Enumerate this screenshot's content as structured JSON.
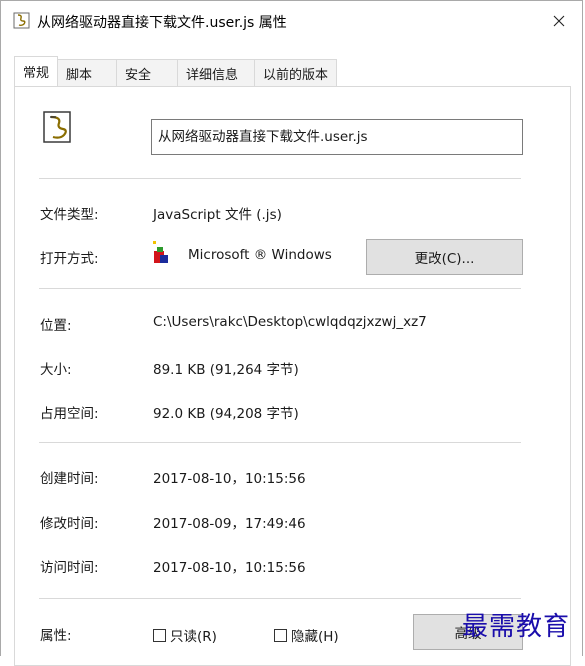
{
  "window": {
    "title": "从网络驱动器直接下载文件.user.js 属性"
  },
  "tabs": [
    {
      "label": "常规",
      "active": true
    },
    {
      "label": "脚本",
      "active": false
    },
    {
      "label": "安全",
      "active": false
    },
    {
      "label": "详细信息",
      "active": false
    },
    {
      "label": "以前的版本",
      "active": false
    }
  ],
  "general": {
    "file_name": "从网络驱动器直接下载文件.user.js",
    "type_label": "文件类型:",
    "type_value": "JavaScript 文件 (.js)",
    "opens_label": "打开方式:",
    "opens_value": "Microsoft ® Windows",
    "change_button": "更改(C)...",
    "location_label": "位置:",
    "location_value": "C:\\Users\\rakc\\Desktop\\cwlqdqzjxzwj_xz7",
    "size_label": "大小:",
    "size_value": "89.1 KB (91,264 字节)",
    "disk_label": "占用空间:",
    "disk_value": "92.0 KB (94,208 字节)",
    "created_label": "创建时间:",
    "created_value": "2017-08-10，10:15:56",
    "modified_label": "修改时间:",
    "modified_value": "2017-08-09，17:49:46",
    "accessed_label": "访问时间:",
    "accessed_value": "2017-08-10，10:15:56",
    "attributes_label": "属性:",
    "readonly_label": "只读(R)",
    "hidden_label": "隐藏(H)",
    "advanced_button": "高级"
  },
  "watermark": "最需教育",
  "colors": {
    "panel_border": "#d9d9d9",
    "button_bg": "#e1e1e1",
    "watermark": "#1a0dab"
  }
}
